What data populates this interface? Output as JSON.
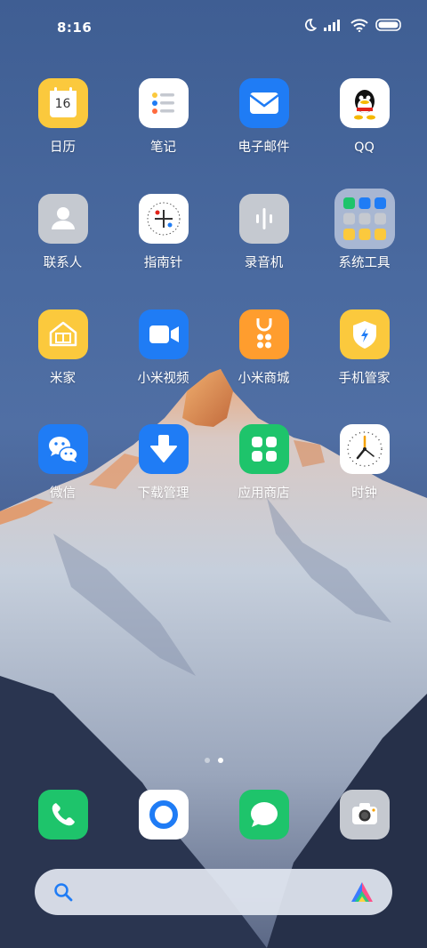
{
  "status_bar": {
    "time": "8:16",
    "icons": [
      "moon-icon",
      "signal-icon",
      "wifi-icon",
      "battery-icon"
    ]
  },
  "apps": [
    {
      "label": "日历",
      "icon": "calendar-icon",
      "day": "16"
    },
    {
      "label": "笔记",
      "icon": "notes-icon"
    },
    {
      "label": "电子邮件",
      "icon": "email-icon"
    },
    {
      "label": "QQ",
      "icon": "qq-icon"
    },
    {
      "label": "联系人",
      "icon": "contacts-icon"
    },
    {
      "label": "指南针",
      "icon": "compass-icon"
    },
    {
      "label": "录音机",
      "icon": "recorder-icon"
    },
    {
      "label": "系统工具",
      "icon": "system-tools-folder-icon"
    },
    {
      "label": "米家",
      "icon": "mijia-icon"
    },
    {
      "label": "小米视频",
      "icon": "video-icon"
    },
    {
      "label": "小米商城",
      "icon": "mi-store-icon"
    },
    {
      "label": "手机管家",
      "icon": "security-icon"
    },
    {
      "label": "微信",
      "icon": "wechat-icon"
    },
    {
      "label": "下载管理",
      "icon": "download-icon"
    },
    {
      "label": "应用商店",
      "icon": "app-store-icon"
    },
    {
      "label": "时钟",
      "icon": "clock-icon"
    }
  ],
  "page_indicator": {
    "pages": 2,
    "current": 2
  },
  "dock": [
    {
      "icon": "phone-icon"
    },
    {
      "icon": "browser-icon"
    },
    {
      "icon": "messages-icon"
    },
    {
      "icon": "camera-icon"
    }
  ],
  "search": {
    "icon": "search-icon",
    "assistant_icon": "assistant-icon"
  },
  "colors": {
    "calendar": "#fbc93d",
    "notes": "#ffffff",
    "email": "#1f7cf5",
    "contacts": "#c5c9d0",
    "recorder": "#c5c9d0",
    "mijia": "#fbc93d",
    "video": "#1f7cf5",
    "mi_store": "#ff9d2e",
    "security": "#fbc93d",
    "wechat": "#1f7cf5",
    "download": "#1f7cf5",
    "app_store": "#1ec46b",
    "phone": "#1ec46b",
    "messages": "#1ec46b"
  }
}
